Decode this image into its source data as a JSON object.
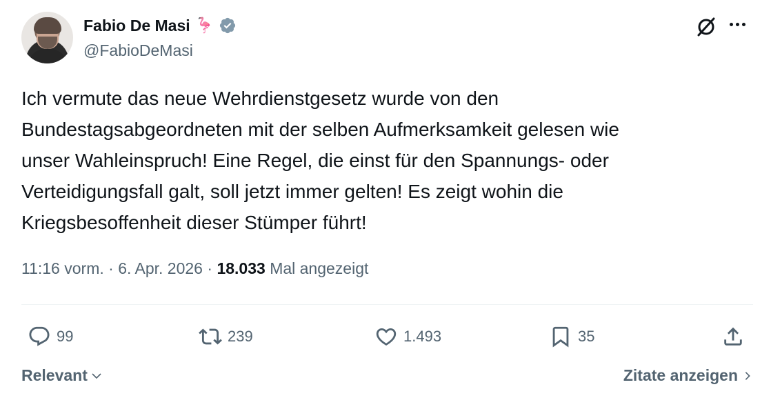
{
  "user": {
    "name": "Fabio De Masi",
    "emoji": "🦩",
    "handle": "@FabioDeMasi"
  },
  "tweet": {
    "text": "Ich vermute das neue Wehrdienstgesetz wurde von den\nBundestagsabgeordneten mit der selben Aufmerksamkeit gelesen wie\nunser Wahleinspruch! Eine Regel, die einst für den Spannungs- oder\nVerteidigungsfall galt, soll jetzt immer gelten! Es zeigt wohin die\nKriegsbesoffenheit dieser Stümper führt!"
  },
  "meta": {
    "time": "11:16 vorm.",
    "separator": " · ",
    "date": "6. Apr. 2026",
    "views": "18.033",
    "views_label": "Mal angezeigt"
  },
  "actions": {
    "replies": "99",
    "retweets": "239",
    "likes": "1.493",
    "bookmarks": "35"
  },
  "footer": {
    "sort_label": "Relevant",
    "quotes_label": "Zitate anzeigen"
  },
  "icons": {
    "reply": "reply-icon",
    "retweet": "retweet-icon",
    "like": "heart-icon",
    "bookmark": "bookmark-icon",
    "share": "share-icon",
    "grok": "grok-icon",
    "more": "more-icon",
    "verified": "verified-badge-icon"
  },
  "colors": {
    "text": "#0f1419",
    "secondary": "#536471",
    "verified": "#829aab"
  }
}
